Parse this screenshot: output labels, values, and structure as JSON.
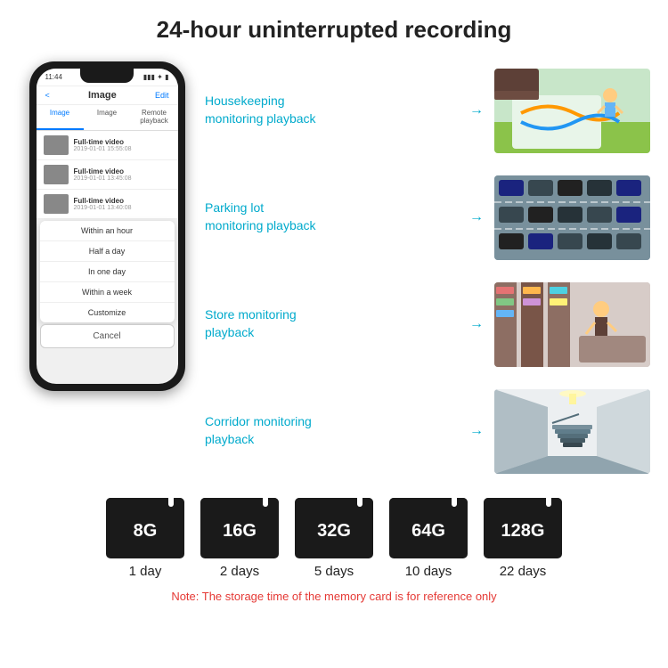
{
  "header": {
    "title": "24-hour uninterrupted recording"
  },
  "phone": {
    "time": "11:44",
    "nav_back": "<",
    "nav_title": "Image",
    "nav_edit": "Edit",
    "tabs": [
      "Image",
      "Image",
      "Remote playback"
    ],
    "list_items": [
      {
        "title": "Full-time video",
        "date": "2019-01-01 15:55:08"
      },
      {
        "title": "Full-time video",
        "date": "2019-01-01 13:45:08"
      },
      {
        "title": "Full-time video",
        "date": "2019-01-01 13:40:08"
      }
    ],
    "dropdown_items": [
      "Within an hour",
      "Half a day",
      "In one day",
      "Within a week",
      "Customize"
    ],
    "cancel_label": "Cancel"
  },
  "monitoring": [
    {
      "label": "Housekeeping\nmonitoring playback",
      "scene": "housekeeping"
    },
    {
      "label": "Parking lot\nmonitoring playback",
      "scene": "parking"
    },
    {
      "label": "Store monitoring\nplayback",
      "scene": "store"
    },
    {
      "label": "Corridor monitoring\nplayback",
      "scene": "corridor"
    }
  ],
  "storage": {
    "cards": [
      {
        "size": "8G",
        "days": "1 day"
      },
      {
        "size": "16G",
        "days": "2 days"
      },
      {
        "size": "32G",
        "days": "5 days"
      },
      {
        "size": "64G",
        "days": "10 days"
      },
      {
        "size": "128G",
        "days": "22 days"
      }
    ],
    "note": "Note: The storage time of the memory card is for reference only"
  }
}
